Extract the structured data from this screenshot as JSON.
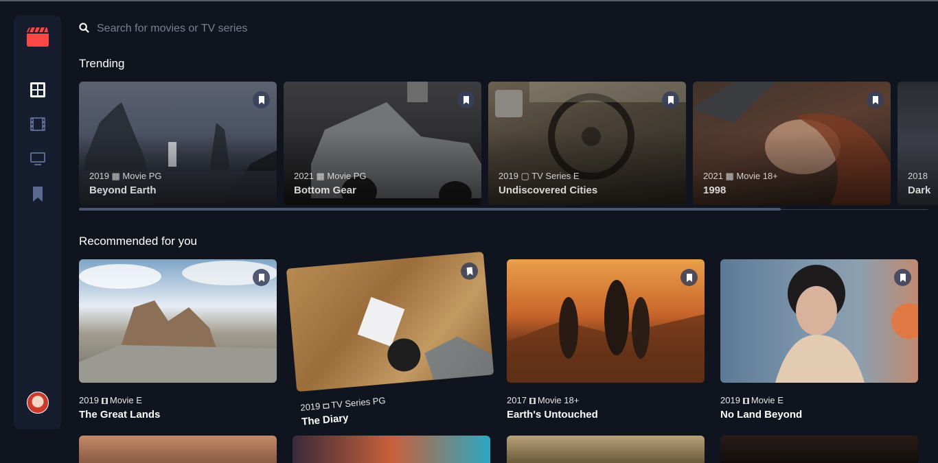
{
  "search": {
    "placeholder": "Search for movies or TV series"
  },
  "sections": {
    "trending": "Trending",
    "recommended": "Recommended for you"
  },
  "trending": [
    {
      "meta": "2019 ▦ Movie PG",
      "title": "Beyond Earth"
    },
    {
      "meta": "2021 ▦ Movie PG",
      "title": "Bottom Gear"
    },
    {
      "meta": "2019 ▢ TV Series E",
      "title": "Undiscovered Cities"
    },
    {
      "meta": "2021 ▦ Movie 18+",
      "title": "1998"
    },
    {
      "meta": "2018",
      "title": "Dark"
    }
  ],
  "recommended": [
    {
      "year": "2019",
      "category": "Movie",
      "rating": "E",
      "title": "The Great Lands"
    },
    {
      "year": "2019",
      "category": "TV Series",
      "rating": "PG",
      "title": "The Diary"
    },
    {
      "year": "2017",
      "category": "Movie",
      "rating": "18+",
      "title": "Earth's Untouched"
    },
    {
      "year": "2019",
      "category": "Movie",
      "rating": "E",
      "title": "No Land Beyond"
    }
  ],
  "colors": {
    "accent": "#fc4747",
    "background": "#10141e",
    "sidebar": "#161d2f",
    "nav_icon": "#5a698f"
  },
  "icons": [
    "logo-icon",
    "home-icon",
    "movies-icon",
    "tv-series-icon",
    "bookmark-icon",
    "search-icon",
    "avatar"
  ]
}
